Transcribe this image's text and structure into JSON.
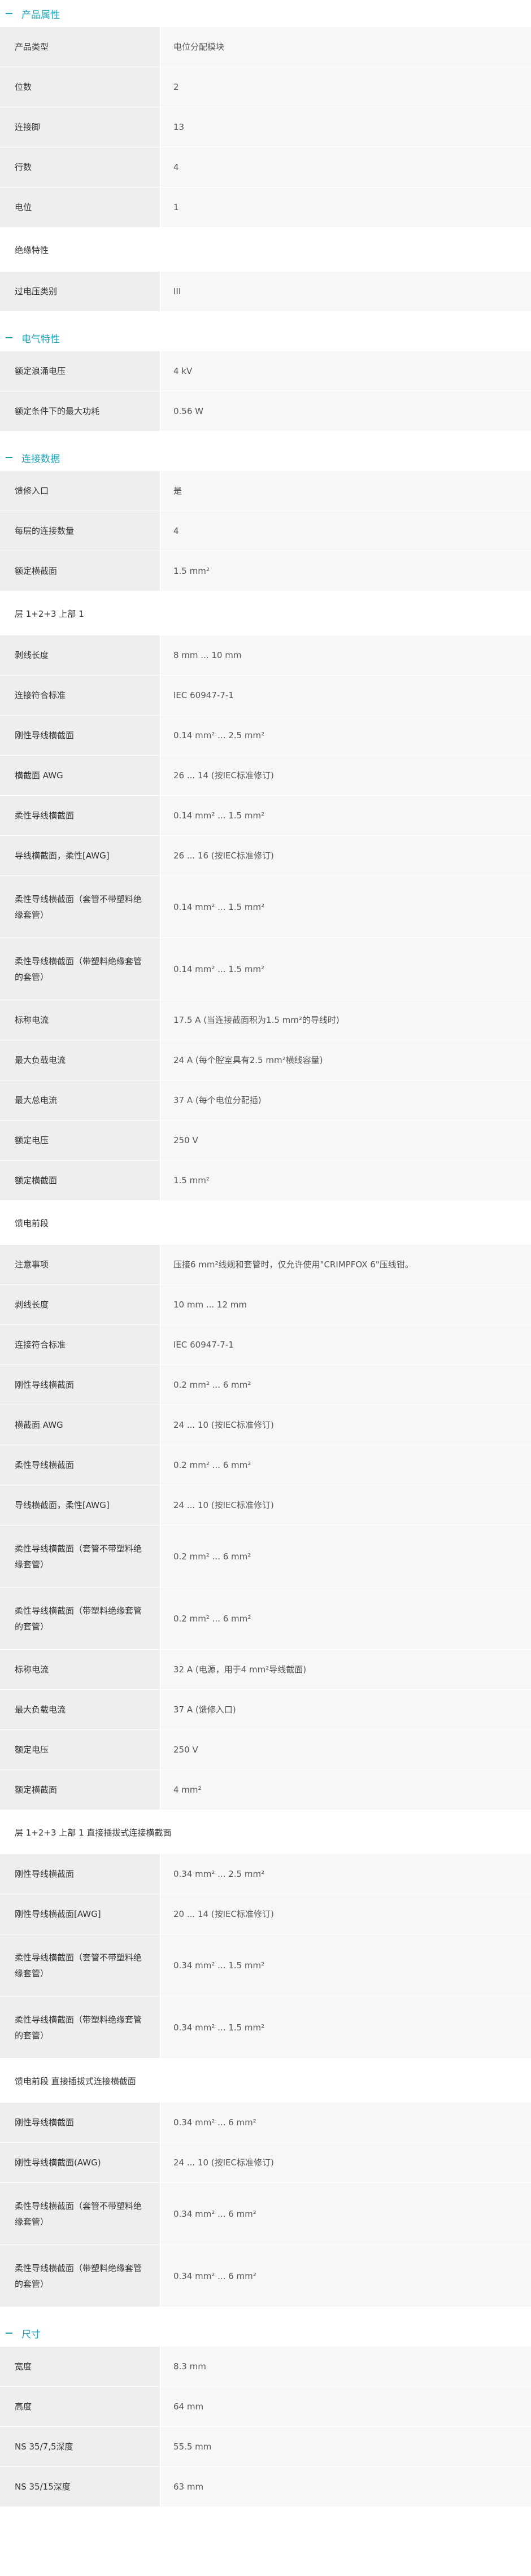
{
  "sections": {
    "product": {
      "title": "产品属性",
      "rows": [
        {
          "label": "产品类型",
          "value": "电位分配模块"
        },
        {
          "label": "位数",
          "value": "2"
        },
        {
          "label": "连接脚",
          "value": "13"
        },
        {
          "label": "行数",
          "value": "4"
        },
        {
          "label": "电位",
          "value": "1"
        }
      ],
      "insulation_title": "绝缘特性",
      "insulation_rows": [
        {
          "label": "过电压类别",
          "value": "III"
        }
      ]
    },
    "electrical": {
      "title": "电气特性",
      "rows": [
        {
          "label": "额定浪涌电压",
          "value": "4 kV"
        },
        {
          "label": "额定条件下的最大功耗",
          "value": "0.56 W"
        }
      ]
    },
    "connection": {
      "title": "连接数据",
      "rows": [
        {
          "label": "馈修入口",
          "value": "是"
        },
        {
          "label": "每层的连接数量",
          "value": "4"
        },
        {
          "label": "额定横截面",
          "value": "1.5 mm²"
        }
      ],
      "group1_title": "层 1+2+3 上部 1",
      "group1_rows": [
        {
          "label": "剥线长度",
          "value": "8 mm ... 10 mm"
        },
        {
          "label": "连接符合标准",
          "value": "IEC 60947-7-1"
        },
        {
          "label": "刚性导线横截面",
          "value": "0.14 mm² ... 2.5 mm²"
        },
        {
          "label": "横截面 AWG",
          "value": "26 ... 14 (按IEC标准修订)"
        },
        {
          "label": "柔性导线横截面",
          "value": "0.14 mm² ... 1.5 mm²"
        },
        {
          "label": "导线横截面，柔性[AWG]",
          "value": "26 ... 16 (按IEC标准修订)"
        },
        {
          "label": "柔性导线横截面（套管不带塑料绝缘套管）",
          "value": "0.14 mm² ... 1.5 mm²"
        },
        {
          "label": "柔性导线横截面（带塑料绝缘套管的套管）",
          "value": "0.14 mm² ... 1.5 mm²"
        },
        {
          "label": "标称电流",
          "value": "17.5 A (当连接截面积为1.5 mm²的导线时)"
        },
        {
          "label": "最大负载电流",
          "value": "24 A (每个腔室具有2.5 mm²横线容量)"
        },
        {
          "label": "最大总电流",
          "value": "37 A (每个电位分配插)"
        },
        {
          "label": "额定电压",
          "value": "250 V"
        },
        {
          "label": "额定横截面",
          "value": "1.5 mm²"
        }
      ],
      "group2_title": "馈电前段",
      "group2_rows": [
        {
          "label": "注意事项",
          "value": "压接6 mm²线规和套管时，仅允许使用\"CRIMPFOX 6\"压线钳。"
        },
        {
          "label": "剥线长度",
          "value": "10 mm ... 12 mm"
        },
        {
          "label": "连接符合标准",
          "value": "IEC 60947-7-1"
        },
        {
          "label": "刚性导线横截面",
          "value": "0.2 mm² ... 6 mm²"
        },
        {
          "label": "横截面 AWG",
          "value": "24 ... 10 (按IEC标准修订)"
        },
        {
          "label": "柔性导线横截面",
          "value": "0.2 mm² ... 6 mm²"
        },
        {
          "label": "导线横截面，柔性[AWG]",
          "value": "24 ... 10 (按IEC标准修订)"
        },
        {
          "label": "柔性导线横截面（套管不带塑料绝缘套管）",
          "value": "0.2 mm² ... 6 mm²"
        },
        {
          "label": "柔性导线横截面（带塑料绝缘套管的套管）",
          "value": "0.2 mm² ... 6 mm²"
        },
        {
          "label": "标称电流",
          "value": "32 A (电源，用于4 mm²导线截面)"
        },
        {
          "label": "最大负载电流",
          "value": "37 A (馈修入口)"
        },
        {
          "label": "额定电压",
          "value": "250 V"
        },
        {
          "label": "额定横截面",
          "value": "4 mm²"
        }
      ],
      "group3_title": "层 1+2+3 上部 1 直接插拔式连接横截面",
      "group3_rows": [
        {
          "label": "刚性导线横截面",
          "value": "0.34 mm² ... 2.5 mm²"
        },
        {
          "label": "刚性导线横截面[AWG]",
          "value": "20 ... 14 (按IEC标准修订)"
        },
        {
          "label": "柔性导线横截面（套管不带塑料绝缘套管）",
          "value": "0.34 mm² ... 1.5 mm²"
        },
        {
          "label": "柔性导线横截面（带塑料绝缘套管的套管）",
          "value": "0.34 mm² ... 1.5 mm²"
        }
      ],
      "group4_title": "馈电前段 直接插拔式连接横截面",
      "group4_rows": [
        {
          "label": "刚性导线横截面",
          "value": "0.34 mm² ... 6 mm²"
        },
        {
          "label": "刚性导线横截面(AWG)",
          "value": "24 ... 10 (按IEC标准修订)"
        },
        {
          "label": "柔性导线横截面（套管不带塑料绝缘套管）",
          "value": "0.34 mm² ... 6 mm²"
        },
        {
          "label": "柔性导线横截面（带塑料绝缘套管的套管）",
          "value": "0.34 mm² ... 6 mm²"
        }
      ]
    },
    "dimensions": {
      "title": "尺寸",
      "rows": [
        {
          "label": "宽度",
          "value": "8.3 mm"
        },
        {
          "label": "高度",
          "value": "64 mm"
        },
        {
          "label": "NS 35/7,5深度",
          "value": "55.5 mm"
        },
        {
          "label": "NS 35/15深度",
          "value": "63 mm"
        }
      ]
    }
  },
  "colors": {
    "accent": "#1fa3b5",
    "label_bg": "#eeeeee",
    "value_bg": "#f7f7f7"
  }
}
